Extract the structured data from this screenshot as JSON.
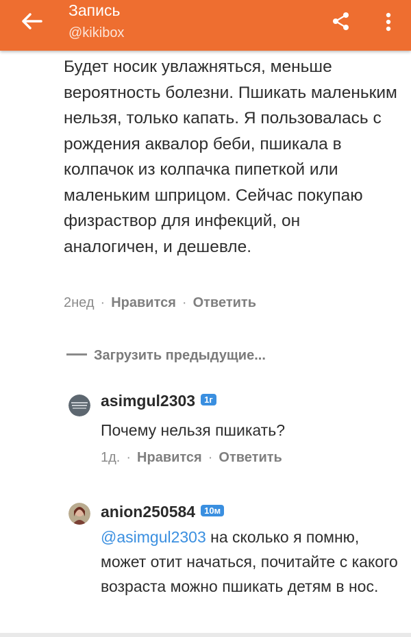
{
  "appbar": {
    "title": "Запись",
    "subtitle": "@kikibox",
    "icons": [
      "back-arrow-icon",
      "share-icon",
      "more-vertical-icon"
    ]
  },
  "main_comment": {
    "text": "Будет носик увлажняться, меньше вероятность болезни. Пшикать маленьким нельзя, только капать. Я пользовалась с рождения аквалор беби, пшикала в колпачок из колпачка пипеткой или маленьким шприцом. Сейчас покупаю физраствор для инфекций, он аналогичен, и дешевле.",
    "time": "2нед",
    "like": "Нравится",
    "reply": "Ответить"
  },
  "load_previous": "Загрузить предыдущие...",
  "replies": [
    {
      "username": "asimgul2303",
      "badge": "1г",
      "text": "Почему нельзя пшикать?",
      "time": "1д.",
      "like": "Нравится",
      "reply": "Ответить"
    },
    {
      "username": "anion250584",
      "badge": "10м",
      "mention": "@asimgul2303",
      "text": " на сколько я помню, может отит начаться, почитайте с какого возраста можно пшикать детям в нос."
    }
  ],
  "colors": {
    "appbar": "#ee6e30",
    "badge": "#3a8fe0",
    "mention": "#3a8fe0"
  }
}
